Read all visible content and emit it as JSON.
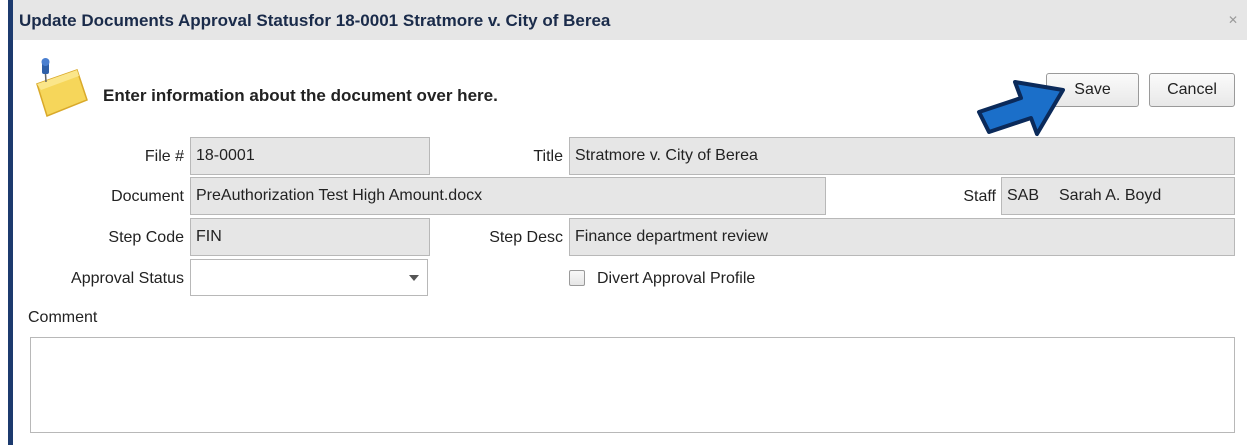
{
  "window": {
    "title": "Update Documents Approval Statusfor 18-0001 Stratmore v. City of Berea",
    "close_glyph": "✕"
  },
  "header": {
    "text": "Enter information about the document over here.",
    "icon": "sticky-note-pin-icon"
  },
  "buttons": {
    "save_label": "Save",
    "cancel_label": "Cancel"
  },
  "pointer_arrow": {
    "icon": "blue-arrow-pointer-icon",
    "color": "#1b6fc9"
  },
  "form": {
    "file_label": "File #",
    "file_value": "18-0001",
    "title_label": "Title",
    "title_value": "Stratmore v. City of Berea",
    "document_label": "Document",
    "document_value": "PreAuthorization Test High Amount.docx",
    "staff_label": "Staff",
    "staff_code": "SAB",
    "staff_name": "Sarah A. Boyd",
    "step_code_label": "Step Code",
    "step_code_value": "FIN",
    "step_desc_label": "Step Desc",
    "step_desc_value": "Finance department review",
    "approval_status_label": "Approval Status",
    "approval_status_value": "",
    "divert_label": "Divert Approval Profile",
    "comment_label": "Comment",
    "comment_value": ""
  },
  "colors": {
    "titlebar_bg": "#e6e6e6",
    "title_text": "#1a2b4a",
    "readonly_field_bg": "#e6e6e6",
    "window_border": "#1c3a6e"
  }
}
